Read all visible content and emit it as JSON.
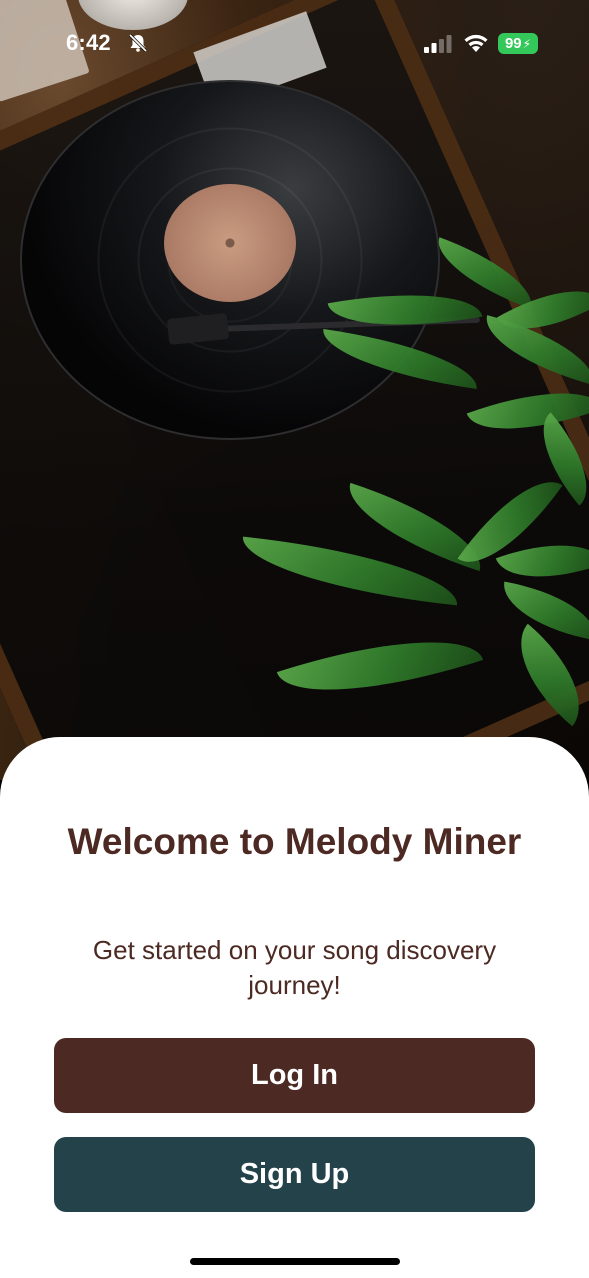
{
  "status_bar": {
    "time": "6:42",
    "battery_level": "99",
    "icons": [
      "bell-slash-icon",
      "cellular-signal-icon",
      "wifi-icon",
      "battery-charging-icon"
    ]
  },
  "hero": {
    "image": "vinyl-record-turntable-with-plant-photo"
  },
  "welcome": {
    "title": "Welcome to Melody Miner",
    "subtitle": "Get started on your song discovery journey!"
  },
  "actions": {
    "login_label": "Log In",
    "signup_label": "Sign Up"
  },
  "colors": {
    "title_text": "#4c2a23",
    "login_button": "#4c2a23",
    "signup_button": "#24424a",
    "battery": "#34c759",
    "sheet_background": "#ffffff"
  }
}
